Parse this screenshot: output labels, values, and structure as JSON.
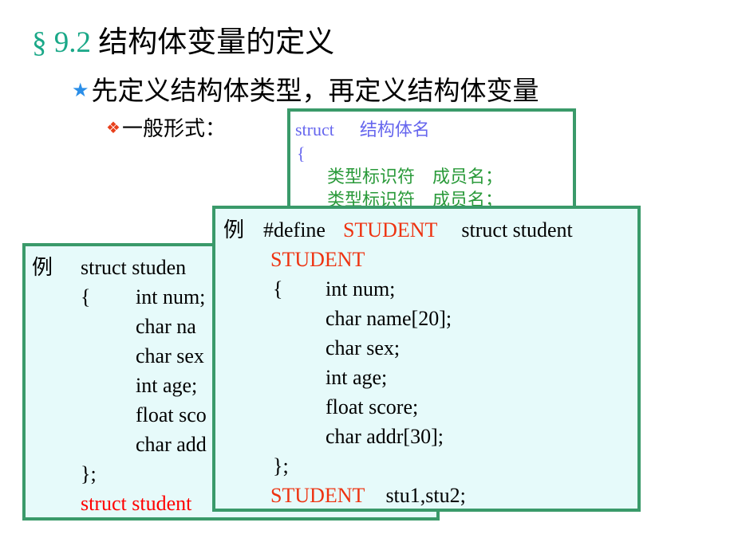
{
  "slide": {
    "title": {
      "section": "§ 9.2",
      "text": "结构体变量的定义"
    },
    "bullet1": {
      "icon": "star-icon",
      "icon_glyph": "★",
      "text": "先定义结构体类型，再定义结构体变量"
    },
    "bullet2": {
      "icon": "diamond-bullet-icon",
      "icon_glyph": "❖",
      "text": "一般形式："
    }
  },
  "general_form_box": {
    "lines": [
      {
        "keyword": "struct",
        "name": "结构体名"
      },
      {
        "text": "{"
      },
      {
        "type": "类型标识符",
        "member": "成员名；"
      },
      {
        "type": "类型标识符",
        "member": "成员名；"
      }
    ],
    "colors": {
      "keyword": "#6666ee",
      "member": "#2a9a3a"
    }
  },
  "example_left": {
    "label": "例",
    "lines": [
      "struct   studen",
      "{",
      "int num;",
      "char  na",
      "char sex",
      "int age;",
      "float sco",
      "char add",
      "};",
      "struct student"
    ]
  },
  "example_front": {
    "label": "例",
    "define": {
      "directive": "#define",
      "macro": "STUDENT",
      "replacement": "struct  student"
    },
    "macro_line": "STUDENT",
    "open_brace": "{",
    "members": [
      "int num;",
      "char  name[20];",
      "char sex;",
      "int age;",
      "float score;",
      "char addr[30];"
    ],
    "close_brace": "};",
    "decl": {
      "type": "STUDENT",
      "vars": "stu1,stu2;"
    }
  },
  "colors": {
    "section": "#1aa888",
    "border": "#3a9a6a",
    "box_bg": "#e6fafa",
    "highlight": "#ee3311"
  }
}
